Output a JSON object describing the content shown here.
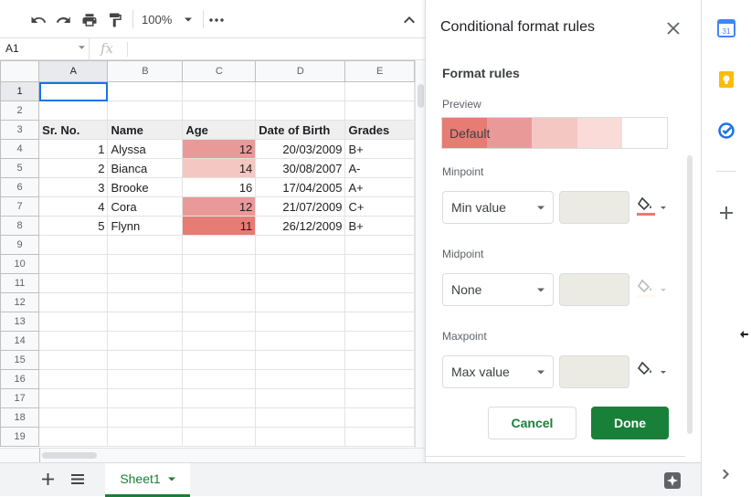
{
  "toolbar": {
    "undo_icon": "undo-icon",
    "redo_icon": "redo-icon",
    "print_icon": "print-icon",
    "paint_format_icon": "paint-format-icon",
    "zoom": "100%",
    "more_icon": "more-horizontal-icon",
    "collapse_icon": "chevron-up-icon"
  },
  "formula_bar": {
    "cell_ref": "A1",
    "fx_label": "fx",
    "value": ""
  },
  "grid": {
    "columns": [
      "A",
      "B",
      "C",
      "D",
      "E"
    ],
    "rows": [
      "1",
      "2",
      "3",
      "4",
      "5",
      "6",
      "7",
      "8",
      "9",
      "10",
      "11",
      "12",
      "13",
      "14",
      "15",
      "16",
      "17",
      "18",
      "19"
    ],
    "headers": [
      "Sr. No.",
      "Name",
      "Age",
      "Date of Birth",
      "Grades"
    ],
    "records": [
      {
        "sr": "1",
        "name": "Alyssa",
        "age": "12",
        "dob": "20/03/2009",
        "grade": "B+",
        "age_bg": "#ea9999"
      },
      {
        "sr": "2",
        "name": "Bianca",
        "age": "14",
        "dob": "30/08/2007",
        "grade": "A-",
        "age_bg": "#f4c7c3"
      },
      {
        "sr": "3",
        "name": "Brooke",
        "age": "16",
        "dob": "17/04/2005",
        "grade": "A+",
        "age_bg": "#ffffff"
      },
      {
        "sr": "4",
        "name": "Cora",
        "age": "12",
        "dob": "21/07/2009",
        "grade": "C+",
        "age_bg": "#ea9999"
      },
      {
        "sr": "5",
        "name": "Flynn",
        "age": "11",
        "dob": "26/12/2009",
        "grade": "B+",
        "age_bg": "#e67c73"
      }
    ]
  },
  "bottom_bar": {
    "add_sheet_icon": "plus-icon",
    "all_sheets_icon": "list-icon",
    "sheet_name": "Sheet1",
    "explore_icon": "explore-icon"
  },
  "panel": {
    "title": "Conditional format rules",
    "section_title": "Format rules",
    "preview_label": "Preview",
    "preview_text": "Default",
    "preview_colors": [
      "#e67c73",
      "#ea9999",
      "#f4c7c3",
      "#fadbd8",
      "#ffffff"
    ],
    "minpoint_label": "Minpoint",
    "minpoint_value": "Min value",
    "minpoint_color": "#e67c73",
    "midpoint_label": "Midpoint",
    "midpoint_value": "None",
    "midpoint_color": "#fff2cc",
    "maxpoint_label": "Maxpoint",
    "maxpoint_value": "Max value",
    "maxpoint_color": "#ffffff",
    "cancel_label": "Cancel",
    "done_label": "Done"
  },
  "rail": {
    "items": [
      "calendar-icon",
      "keep-icon",
      "tasks-icon",
      "add-icon",
      "expand-icon"
    ],
    "calendar_day": "31"
  },
  "colors": {
    "accent_green": "#188038",
    "selection_blue": "#1a73e8"
  }
}
